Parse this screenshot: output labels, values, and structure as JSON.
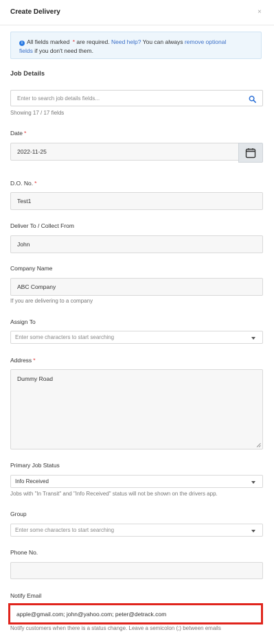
{
  "header": {
    "title": "Create Delivery",
    "close": "×"
  },
  "notice": {
    "text_a": "All fields marked",
    "asterisk": "*",
    "text_b": "are required.",
    "help_link": "Need help?",
    "text_c": "You can always",
    "optional_link_a": "remove optional",
    "optional_link_b": "fields",
    "text_d": "if you don't need them."
  },
  "section_title": "Job Details",
  "search": {
    "placeholder": "Enter to search job details fields...",
    "showing": "Showing 17 / 17 fields"
  },
  "fields": {
    "date": {
      "label": "Date",
      "value": "2022-11-25"
    },
    "do_no": {
      "label": "D.O. No.",
      "value": "Test1"
    },
    "deliver_to": {
      "label": "Deliver To / Collect From",
      "value": "John"
    },
    "company": {
      "label": "Company Name",
      "value": "ABC Company",
      "help": "If you are delivering to a company"
    },
    "assign_to": {
      "label": "Assign To",
      "placeholder": "Enter some characters to start searching"
    },
    "address": {
      "label": "Address",
      "value": "Dummy Road"
    },
    "primary_status": {
      "label": "Primary Job Status",
      "value": "Info Received",
      "help": "Jobs with \"In Transit\" and \"Info Received\" status will not be shown on the drivers app."
    },
    "group": {
      "label": "Group",
      "placeholder": "Enter some characters to start searching"
    },
    "phone": {
      "label": "Phone No.",
      "value": ""
    },
    "notify_email": {
      "label": "Notify Email",
      "value": "apple@gmail.com; john@yahoo.com; peter@detrack.com",
      "help": "Notify customers when there is a status change. Leave a semicolon (;) between emails"
    }
  },
  "required_mark": "*",
  "colors": {
    "highlight": "#e0241c",
    "link": "#3b6fc7",
    "notice_bg": "#eef6fc"
  }
}
